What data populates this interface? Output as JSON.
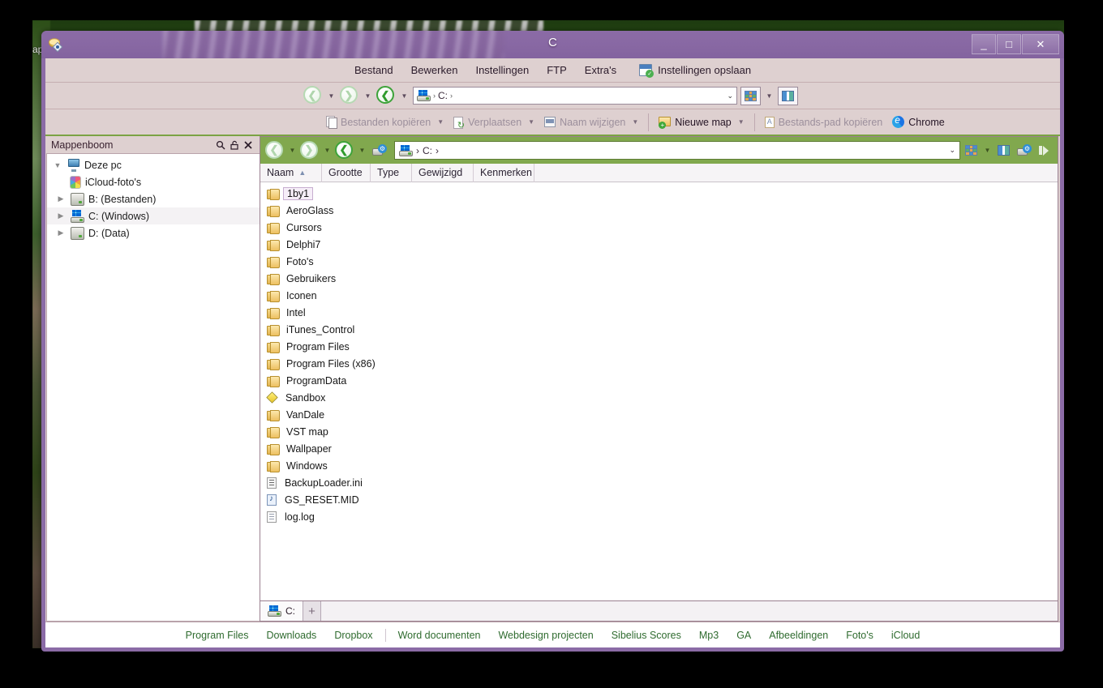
{
  "window": {
    "title": "C",
    "minimize_label": "_",
    "maximize_label": "□",
    "close_label": "✕",
    "app_icon_name": "multi-commander-icon"
  },
  "desktop": {
    "icon_label_fragment": "app"
  },
  "menubar": {
    "items": [
      "Bestand",
      "Bewerken",
      "Instellingen",
      "FTP",
      "Extra's"
    ],
    "save_settings_label": "Instellingen opslaan"
  },
  "navbar": {
    "back_label": "←",
    "forward_label": "→",
    "up_label": "↑",
    "address_value": "C:",
    "address_separator": "›",
    "dropdown_label": "⌄"
  },
  "commandbar": {
    "buttons": [
      {
        "label": "Bestanden kopiëren",
        "icon": "copy-files-icon",
        "enabled": false,
        "has_menu": true
      },
      {
        "label": "Verplaatsen",
        "icon": "move-icon",
        "enabled": false,
        "has_menu": true
      },
      {
        "label": "Naam wijzigen",
        "icon": "rename-icon",
        "enabled": false,
        "has_menu": true
      },
      {
        "label": "Nieuwe map",
        "icon": "new-folder-icon",
        "enabled": true,
        "has_menu": true
      },
      {
        "label": "Bestands-pad kopiëren",
        "icon": "copy-path-icon",
        "enabled": false,
        "has_menu": false
      },
      {
        "label": "Chrome",
        "icon": "chrome-icon",
        "enabled": true,
        "has_menu": false
      }
    ]
  },
  "sidebar": {
    "title": "Mappenboom",
    "header_icons": [
      "search-icon",
      "unpin-icon",
      "close-icon"
    ],
    "tree": [
      {
        "label": "Deze pc",
        "icon": "computer-icon",
        "level": 0,
        "twisty": "▼",
        "selected": false
      },
      {
        "label": "iCloud-foto's",
        "icon": "icloud-photos-icon",
        "level": 2,
        "twisty": "",
        "selected": false
      },
      {
        "label": "B: (Bestanden)",
        "icon": "drive-icon",
        "level": 1,
        "twisty": "▶",
        "selected": false
      },
      {
        "label": "C: (Windows)",
        "icon": "windows-drive-icon",
        "level": 1,
        "twisty": "▶",
        "selected": true
      },
      {
        "label": "D: (Data)",
        "icon": "drive-icon",
        "level": 1,
        "twisty": "▶",
        "selected": false
      }
    ]
  },
  "pane": {
    "toolbar": {
      "back_label": "←",
      "forward_label": "→",
      "up_label": "↑",
      "address_value": "C:",
      "address_separator": "›",
      "dropdown_label": "⌄",
      "right_icons": [
        "grid-view-icon",
        "dual-pane-icon",
        "drive-settings-icon",
        "expand-icon"
      ]
    },
    "columns": [
      {
        "label": "Naam",
        "sorted": true,
        "sort_arrow": "▲"
      },
      {
        "label": "Grootte",
        "sorted": false,
        "sort_arrow": ""
      },
      {
        "label": "Type",
        "sorted": false,
        "sort_arrow": ""
      },
      {
        "label": "Gewijzigd",
        "sorted": false,
        "sort_arrow": ""
      },
      {
        "label": "Kenmerken",
        "sorted": false,
        "sort_arrow": ""
      }
    ],
    "files": [
      {
        "name": "1by1",
        "icon": "folder-icon",
        "selected": true
      },
      {
        "name": "AeroGlass",
        "icon": "folder-icon",
        "selected": false
      },
      {
        "name": "Cursors",
        "icon": "folder-icon",
        "selected": false
      },
      {
        "name": "Delphi7",
        "icon": "folder-icon",
        "selected": false
      },
      {
        "name": "Foto's",
        "icon": "folder-icon",
        "selected": false
      },
      {
        "name": "Gebruikers",
        "icon": "folder-icon",
        "selected": false
      },
      {
        "name": "Iconen",
        "icon": "folder-icon",
        "selected": false
      },
      {
        "name": "Intel",
        "icon": "folder-icon",
        "selected": false
      },
      {
        "name": "iTunes_Control",
        "icon": "folder-icon",
        "selected": false
      },
      {
        "name": "Program Files",
        "icon": "folder-icon",
        "selected": false
      },
      {
        "name": "Program Files (x86)",
        "icon": "folder-icon",
        "selected": false
      },
      {
        "name": "ProgramData",
        "icon": "folder-icon",
        "selected": false
      },
      {
        "name": "Sandbox",
        "icon": "sandbox-icon",
        "selected": false
      },
      {
        "name": "VanDale",
        "icon": "folder-icon",
        "selected": false
      },
      {
        "name": "VST map",
        "icon": "folder-icon",
        "selected": false
      },
      {
        "name": "Wallpaper",
        "icon": "folder-icon",
        "selected": false
      },
      {
        "name": "Windows",
        "icon": "folder-icon",
        "selected": false
      },
      {
        "name": "BackupLoader.ini",
        "icon": "ini-file-icon",
        "selected": false
      },
      {
        "name": "GS_RESET.MID",
        "icon": "midi-file-icon",
        "selected": false
      },
      {
        "name": "log.log",
        "icon": "log-file-icon",
        "selected": false
      }
    ],
    "tabs": [
      {
        "label": "C:",
        "icon": "windows-drive-icon",
        "active": true
      }
    ],
    "add_tab_label": "+"
  },
  "bookmarks": [
    {
      "label": "Program Files",
      "sep_after": false
    },
    {
      "label": "Downloads",
      "sep_after": false
    },
    {
      "label": "Dropbox",
      "sep_after": true
    },
    {
      "label": "Word documenten",
      "sep_after": false
    },
    {
      "label": "Webdesign projecten",
      "sep_after": false
    },
    {
      "label": "Sibelius Scores",
      "sep_after": false
    },
    {
      "label": "Mp3",
      "sep_after": false
    },
    {
      "label": "GA",
      "sep_after": false
    },
    {
      "label": "Afbeeldingen",
      "sep_after": false
    },
    {
      "label": "Foto's",
      "sep_after": false
    },
    {
      "label": "iCloud",
      "sep_after": false
    }
  ],
  "colors": {
    "window_frame": "#8b6ba6",
    "chrome_bg": "#ded0d0",
    "pane_toolbar_green": "#81a84e",
    "bookmark_text": "#2f6b2f",
    "selection_bg": "#f6eef8",
    "desktop_green": "#2c5216"
  }
}
